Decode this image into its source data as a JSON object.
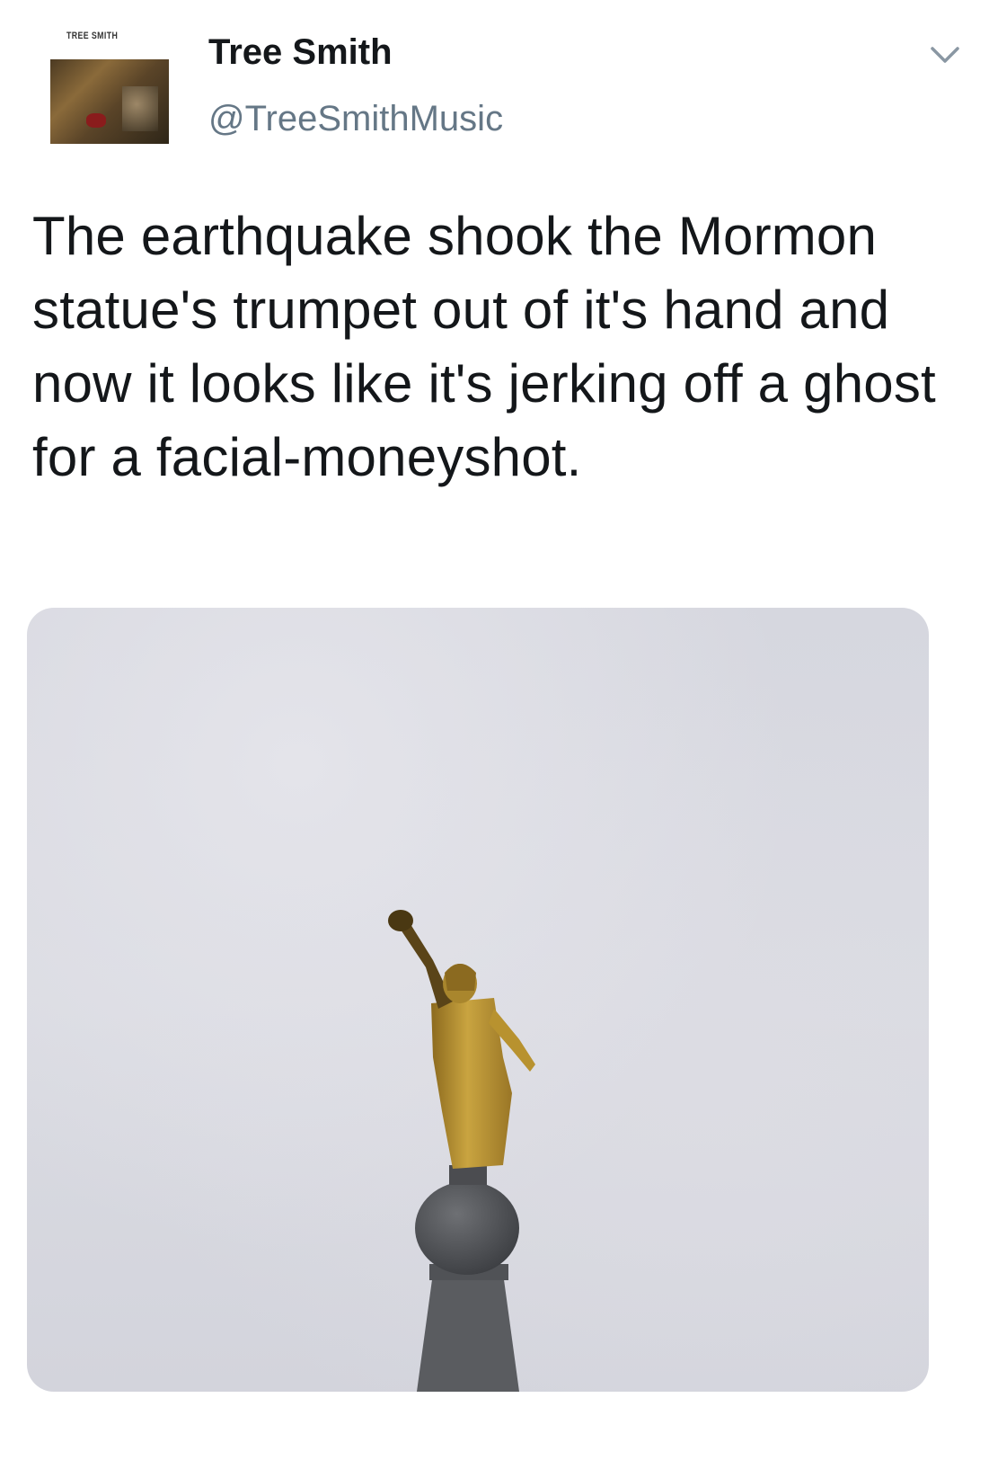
{
  "tweet": {
    "avatar": {
      "brand_text": "TREE SMITH"
    },
    "display_name": "Tree Smith",
    "handle": "@TreeSmithMusic",
    "text": "The earthquake shook the Mormon statue's trumpet out of it's hand and now it looks like it's jerking off a ghost for a facial-moneyshot.",
    "menu_icon": "chevron-down-icon",
    "colors": {
      "name": "#14171a",
      "handle": "#657786",
      "text": "#14171a",
      "background": "#ffffff"
    }
  }
}
